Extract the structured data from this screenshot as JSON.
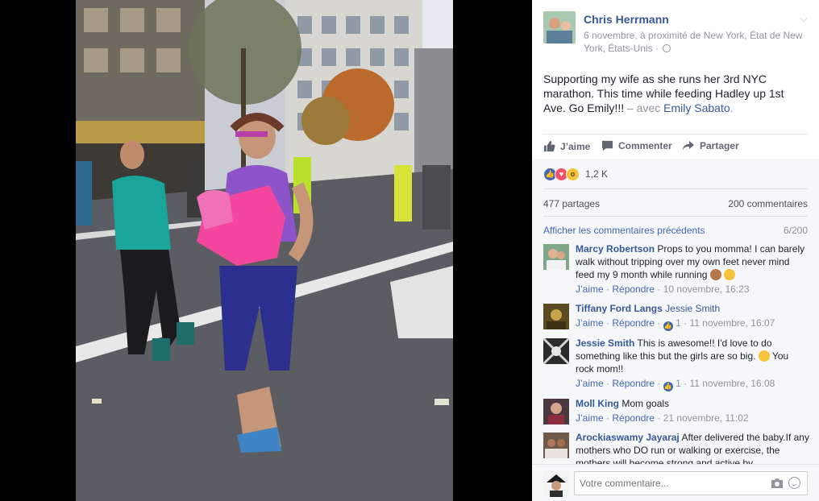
{
  "post": {
    "author": "Chris Herrmann",
    "meta": "6 novembre, à proximité de New York, État de New York, États-Unis ·",
    "text": "Supporting my wife as she runs her 3rd NYC marathon. This time while feeding Hadley up 1st Ave. Go Emily!!!",
    "with_text": "– avec",
    "tagged": "Emily Sabato",
    "tagged_suffix": "."
  },
  "actions": {
    "like": "J’aime",
    "comment": "Commenter",
    "share": "Partager"
  },
  "stats": {
    "reactions_count": "1,2 K",
    "shares": "477 partages",
    "comments": "200 commentaires"
  },
  "comments_nav": {
    "previous": "Afficher les commentaires précédents",
    "page": "6/200"
  },
  "comments": [
    {
      "name": "Marcy Robertson",
      "text": "Props to you momma! I can barely walk without tripping over my own feet never mind feed my 9 month while running",
      "like": "J’aime",
      "reply": "Répondre",
      "time": "10 novembre, 16:23"
    },
    {
      "name": "Tiffany Ford Langs",
      "tag": "Jessie Smith",
      "like": "J’aime",
      "reply": "Répondre",
      "likes": "1",
      "time": "11 novembre, 16:07"
    },
    {
      "name": "Jessie Smith",
      "text": "This is awesome!! I'd love to do something like this but the girls are so big.",
      "text2": "You rock mom!!",
      "like": "J’aime",
      "reply": "Répondre",
      "likes": "1",
      "time": "11 novembre, 16:08"
    },
    {
      "name": "Moll King",
      "text": "Mom goals",
      "like": "J’aime",
      "reply": "Répondre",
      "time": "21 novembre, 11:02"
    },
    {
      "name": "Arockiaswamy Jayaraj",
      "text": "After delivered the baby.If any mothers who DO run or walking or exercise, the mothers will become strong and active by"
    }
  ],
  "compose": {
    "placeholder": "Votre commentaire..."
  },
  "icons": {
    "globe": "globe-icon",
    "chevron": "chevron-down-icon",
    "like": "thumbs-up-icon",
    "comment": "comment-bubble-icon",
    "share": "share-arrow-icon",
    "camera": "camera-icon",
    "smiley": "smiley-icon"
  },
  "colors": {
    "link": "#365899",
    "action_link": "#4267b2",
    "muted": "#90949c",
    "like_reaction": "#4267b2",
    "love_reaction": "#f25268",
    "wow_reaction": "#f7c33b"
  }
}
